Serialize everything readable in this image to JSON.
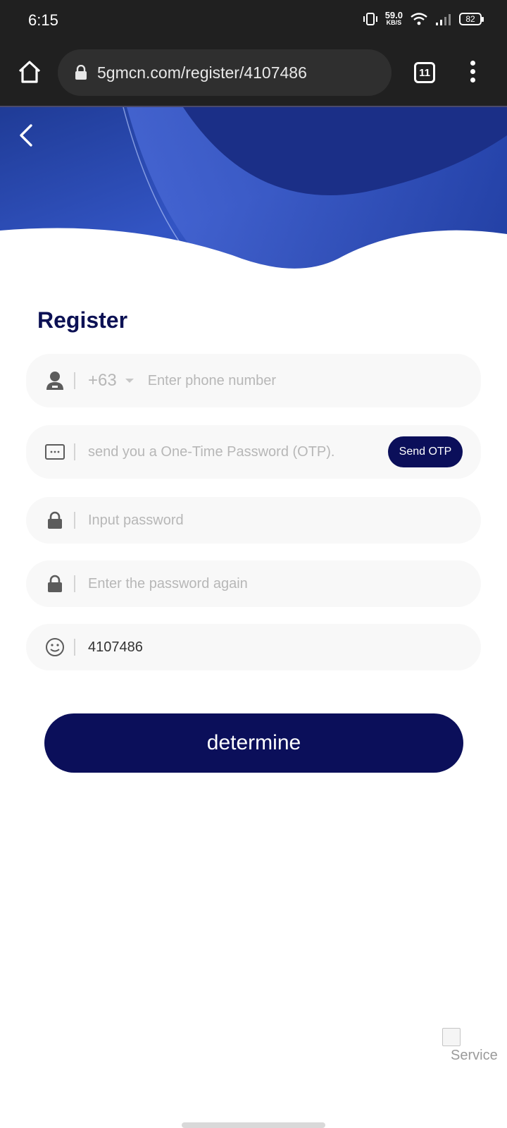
{
  "status": {
    "time": "6:15",
    "speed": "59.0",
    "speed_unit": "KB/S",
    "battery": "82"
  },
  "browser": {
    "url": "5gmcn.com/register/4107486",
    "tab_count": "11"
  },
  "hero": {
    "caption": ""
  },
  "form": {
    "title": "Register",
    "phone": {
      "country_code": "+63",
      "placeholder": "Enter phone number"
    },
    "otp": {
      "placeholder": "send you a One-Time Password (OTP).",
      "button": "Send OTP"
    },
    "password": {
      "placeholder": "Input password"
    },
    "confirm_password": {
      "placeholder": "Enter the password again"
    },
    "invite_code": {
      "value": "4107486"
    },
    "submit": "determine"
  },
  "service": {
    "label": "Service"
  },
  "colors": {
    "primary": "#0b0f5a",
    "hero_blue": "#2b4bb8",
    "field_bg": "#f8f8f8"
  }
}
